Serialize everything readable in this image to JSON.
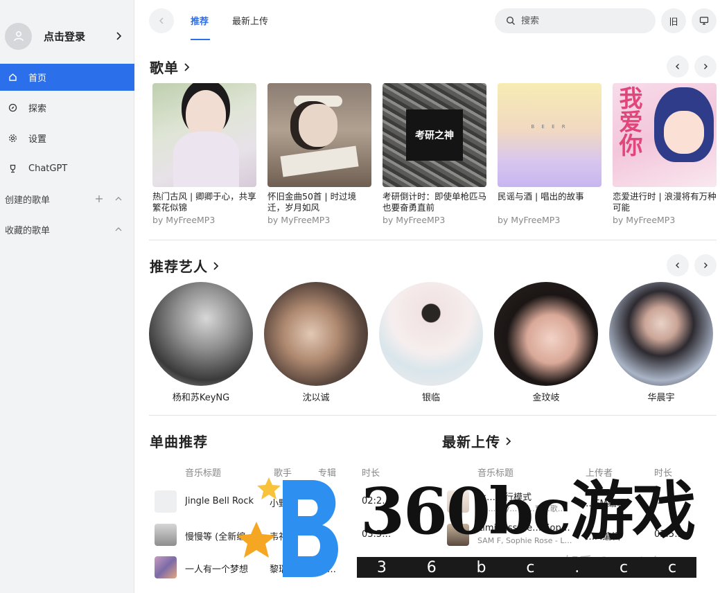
{
  "sidebar": {
    "login_label": "点击登录",
    "nav": [
      {
        "label": "首页",
        "icon": "home-icon",
        "active": true
      },
      {
        "label": "探索",
        "icon": "compass-icon",
        "active": false
      },
      {
        "label": "设置",
        "icon": "gear-icon",
        "active": false
      },
      {
        "label": "ChatGPT",
        "icon": "trophy-icon",
        "active": false
      }
    ],
    "created_playlists_label": "创建的歌单",
    "collected_playlists_label": "收藏的歌单"
  },
  "topbar": {
    "tabs": [
      {
        "label": "推荐",
        "active": true
      },
      {
        "label": "最新上传",
        "active": false
      }
    ],
    "search_placeholder": "搜索",
    "old_label": "旧"
  },
  "playlists": {
    "title": "歌单",
    "items": [
      {
        "title": "热门古风 | 卿卿于心，共享繁花似锦",
        "author": "by MyFreeMP3"
      },
      {
        "title": "怀旧金曲50首 | 时过境迁，岁月如风",
        "author": "by MyFreeMP3"
      },
      {
        "title": "考研倒计时：即使单枪匹马 也要奋勇直前",
        "author": "by MyFreeMP3",
        "cover_text": "考研之神"
      },
      {
        "title": "民谣与酒 | 唱出的故事",
        "author": "by MyFreeMP3",
        "cover_text": "B  E  E  R"
      },
      {
        "title": "恋爱进行时 | 浪漫将有万种可能",
        "author": "by MyFreeMP3",
        "cover_text": "我爱你"
      }
    ]
  },
  "artists": {
    "title": "推荐艺人",
    "items": [
      {
        "name": "杨和苏KeyNG"
      },
      {
        "name": "沈以诚"
      },
      {
        "name": "银临"
      },
      {
        "name": "金玟岐"
      },
      {
        "name": "华晨宇"
      }
    ]
  },
  "songs": {
    "title": "单曲推荐",
    "headers": {
      "title": "音乐标题",
      "artist": "歌手",
      "album": "专辑",
      "duration": "时长"
    },
    "rows": [
      {
        "title": "Jingle Bell Rock",
        "artist": "小野",
        "album": "小…",
        "duration": "02:2…"
      },
      {
        "title": "慢慢等 (全新编…",
        "artist": "韦礼安",
        "album": "慢…",
        "duration": "03:5…"
      },
      {
        "title": "一人有一个梦想",
        "artist": "黎瑞…",
        "album": "继…",
        "duration": ""
      }
    ]
  },
  "uploads": {
    "title": "最新上传",
    "headers": {
      "title": "音乐标题",
      "uploader": "上传者",
      "duration": "时长"
    },
    "rows": [
      {
        "title": "永…飞行模式",
        "sub": "De… Jay… 上…育…歌…",
        "uploader": "…FM编辑",
        "duration": "…"
      },
      {
        "title": "Limitless (fe… Sop…",
        "sub": "SAM F, Sophie Rose - L…",
        "uploader": "…M编辑",
        "duration": "03:5…"
      }
    ]
  },
  "watermark": {
    "text": "360bc游戏",
    "url_chars": [
      "3",
      "6",
      "b",
      "c",
      ".",
      "c",
      "c"
    ],
    "zhihu": "知乎 @crystal"
  },
  "colors": {
    "accent": "#2b6fea",
    "sidebar_bg": "#f2f3f5"
  }
}
